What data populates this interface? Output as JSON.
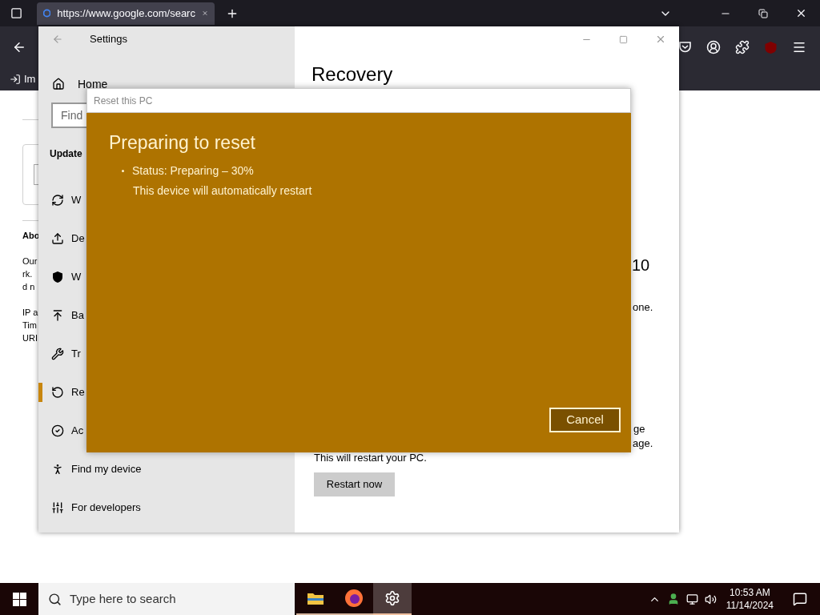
{
  "browser": {
    "tab": {
      "title": "https://www.google.com/searc",
      "selected": true
    },
    "bookmarks": [
      {
        "label": "Im"
      }
    ],
    "page": {
      "heading": "Abo",
      "lines_1": [
        "Our",
        "rk.",
        "d n"
      ],
      "lines_2": [
        "IP a",
        "Tim",
        "URI"
      ]
    }
  },
  "settings": {
    "title": "Settings",
    "sidebar": {
      "home": "Home",
      "search_placeholder": "Find",
      "section": "Update",
      "items": [
        {
          "label": "W",
          "selected": false
        },
        {
          "label": "De",
          "selected": false
        },
        {
          "label": "W",
          "selected": false
        },
        {
          "label": "Ba",
          "selected": false
        },
        {
          "label": "Tr",
          "selected": false
        },
        {
          "label": "Re",
          "selected": true
        },
        {
          "label": "Ac",
          "selected": false
        },
        {
          "label": "Find my device",
          "selected": false
        },
        {
          "label": "For developers",
          "selected": false
        }
      ]
    },
    "content": {
      "heading": "Recovery",
      "fragment_1": "10",
      "fragment_2": "one.",
      "fragment_3": "ge",
      "fragment_4": "age.",
      "note": "This will restart your PC.",
      "button": "Restart now"
    }
  },
  "dialog": {
    "title": "Reset this PC",
    "heading": "Preparing to reset",
    "status": "Status: Preparing – 30%",
    "note": "This device will automatically restart",
    "button": "Cancel"
  },
  "taskbar": {
    "search_placeholder": "Type here to search",
    "apps": [
      {
        "kind": "explorer",
        "active": false
      },
      {
        "kind": "firefox",
        "active": false
      },
      {
        "kind": "settings",
        "active": true
      }
    ],
    "time": "10:53 AM",
    "date": "11/14/2024"
  }
}
